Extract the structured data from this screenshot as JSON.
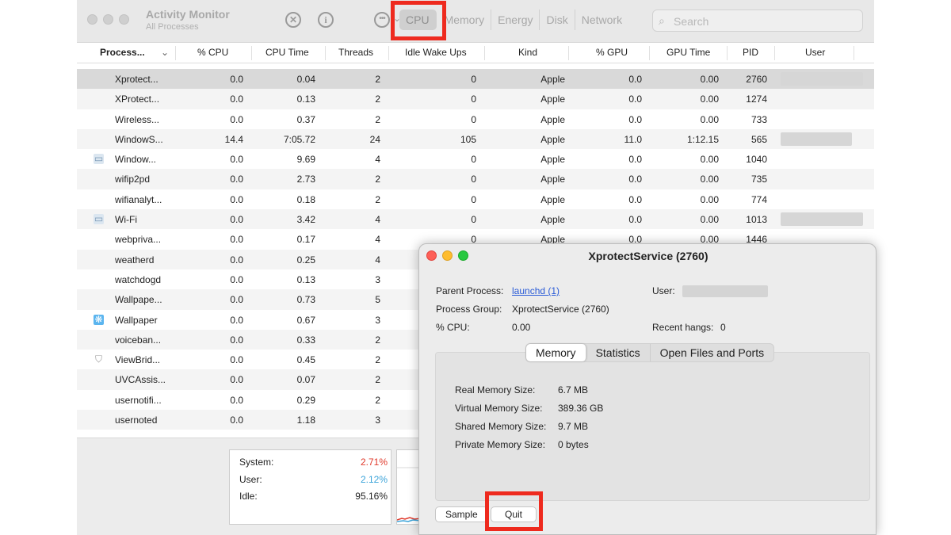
{
  "app": {
    "title": "Activity Monitor",
    "subtitle": "All Processes"
  },
  "toolbar": {
    "stop_icon": "stop-x-icon",
    "info_icon": "info-icon",
    "more_icon": "ellipsis-icon",
    "tabs": [
      "CPU",
      "Memory",
      "Energy",
      "Disk",
      "Network"
    ],
    "active_tab": "CPU",
    "search_placeholder": "Search"
  },
  "table": {
    "columns": [
      "Process...",
      "% CPU",
      "CPU Time",
      "Threads",
      "Idle Wake Ups",
      "Kind",
      "% GPU",
      "GPU Time",
      "PID",
      "User"
    ],
    "rows": [
      {
        "name": "Xprotect...",
        "cpu": "0.0",
        "time": "0.04",
        "threads": "2",
        "idle": "0",
        "kind": "Apple",
        "gpu": "0.0",
        "gputime": "0.00",
        "pid": "2760",
        "icon": ""
      },
      {
        "name": "XProtect...",
        "cpu": "0.0",
        "time": "0.13",
        "threads": "2",
        "idle": "0",
        "kind": "Apple",
        "gpu": "0.0",
        "gputime": "0.00",
        "pid": "1274",
        "icon": ""
      },
      {
        "name": "Wireless...",
        "cpu": "0.0",
        "time": "0.37",
        "threads": "2",
        "idle": "0",
        "kind": "Apple",
        "gpu": "0.0",
        "gputime": "0.00",
        "pid": "733",
        "icon": ""
      },
      {
        "name": "WindowS...",
        "cpu": "14.4",
        "time": "7:05.72",
        "threads": "24",
        "idle": "105",
        "kind": "Apple",
        "gpu": "11.0",
        "gputime": "1:12.15",
        "pid": "565",
        "icon": ""
      },
      {
        "name": "Window...",
        "cpu": "0.0",
        "time": "9.69",
        "threads": "4",
        "idle": "0",
        "kind": "Apple",
        "gpu": "0.0",
        "gputime": "0.00",
        "pid": "1040",
        "icon": "window-app-icon"
      },
      {
        "name": "wifip2pd",
        "cpu": "0.0",
        "time": "2.73",
        "threads": "2",
        "idle": "0",
        "kind": "Apple",
        "gpu": "0.0",
        "gputime": "0.00",
        "pid": "735",
        "icon": ""
      },
      {
        "name": "wifianalyt...",
        "cpu": "0.0",
        "time": "0.18",
        "threads": "2",
        "idle": "0",
        "kind": "Apple",
        "gpu": "0.0",
        "gputime": "0.00",
        "pid": "774",
        "icon": ""
      },
      {
        "name": "Wi-Fi",
        "cpu": "0.0",
        "time": "3.42",
        "threads": "4",
        "idle": "0",
        "kind": "Apple",
        "gpu": "0.0",
        "gputime": "0.00",
        "pid": "1013",
        "icon": "wifi-app-icon"
      },
      {
        "name": "webpriva...",
        "cpu": "0.0",
        "time": "0.17",
        "threads": "4",
        "idle": "0",
        "kind": "Apple",
        "gpu": "0.0",
        "gputime": "0.00",
        "pid": "1446",
        "icon": ""
      },
      {
        "name": "weatherd",
        "cpu": "0.0",
        "time": "0.25",
        "threads": "4",
        "idle": "",
        "kind": "",
        "gpu": "",
        "gputime": "",
        "pid": "",
        "icon": ""
      },
      {
        "name": "watchdogd",
        "cpu": "0.0",
        "time": "0.13",
        "threads": "3",
        "idle": "",
        "kind": "",
        "gpu": "",
        "gputime": "",
        "pid": "",
        "icon": ""
      },
      {
        "name": "Wallpape...",
        "cpu": "0.0",
        "time": "0.73",
        "threads": "5",
        "idle": "",
        "kind": "",
        "gpu": "",
        "gputime": "",
        "pid": "",
        "icon": ""
      },
      {
        "name": "Wallpaper",
        "cpu": "0.0",
        "time": "0.67",
        "threads": "3",
        "idle": "",
        "kind": "",
        "gpu": "",
        "gputime": "",
        "pid": "",
        "icon": "wallpaper-app-icon"
      },
      {
        "name": "voiceban...",
        "cpu": "0.0",
        "time": "0.33",
        "threads": "2",
        "idle": "",
        "kind": "",
        "gpu": "",
        "gputime": "",
        "pid": "",
        "icon": ""
      },
      {
        "name": "ViewBrid...",
        "cpu": "0.0",
        "time": "0.45",
        "threads": "2",
        "idle": "",
        "kind": "",
        "gpu": "",
        "gputime": "",
        "pid": "",
        "icon": "shield-icon"
      },
      {
        "name": "UVCAssis...",
        "cpu": "0.0",
        "time": "0.07",
        "threads": "2",
        "idle": "",
        "kind": "",
        "gpu": "",
        "gputime": "",
        "pid": "",
        "icon": ""
      },
      {
        "name": "usernotifi...",
        "cpu": "0.0",
        "time": "0.29",
        "threads": "2",
        "idle": "",
        "kind": "",
        "gpu": "",
        "gputime": "",
        "pid": "",
        "icon": ""
      },
      {
        "name": "usernoted",
        "cpu": "0.0",
        "time": "1.18",
        "threads": "3",
        "idle": "",
        "kind": "",
        "gpu": "",
        "gputime": "",
        "pid": "",
        "icon": ""
      }
    ]
  },
  "cpu_stats": {
    "system_label": "System:",
    "system_value": "2.71%",
    "user_label": "User:",
    "user_value": "2.12%",
    "idle_label": "Idle:",
    "idle_value": "95.16%",
    "system_color": "#e0392b",
    "user_color": "#3aa3d9"
  },
  "dialog": {
    "title": "XprotectService (2760)",
    "parent_label": "Parent Process:",
    "parent_value": "launchd (1)",
    "group_label": "Process Group:",
    "group_value": "XprotectService (2760)",
    "cpu_label": "% CPU:",
    "cpu_value": "0.00",
    "user_label": "User:",
    "hangs_label": "Recent hangs:",
    "hangs_value": "0",
    "tabs": [
      "Memory",
      "Statistics",
      "Open Files and Ports"
    ],
    "active_tab": "Memory",
    "memory": [
      {
        "label": "Real Memory Size:",
        "value": "6.7 MB"
      },
      {
        "label": "Virtual Memory Size:",
        "value": "389.36 GB"
      },
      {
        "label": "Shared Memory Size:",
        "value": "9.7 MB"
      },
      {
        "label": "Private Memory Size:",
        "value": "0 bytes"
      }
    ],
    "sample_label": "Sample",
    "quit_label": "Quit"
  },
  "colors": {
    "highlight": "#ee2a1e",
    "link": "#2a5bd7"
  }
}
